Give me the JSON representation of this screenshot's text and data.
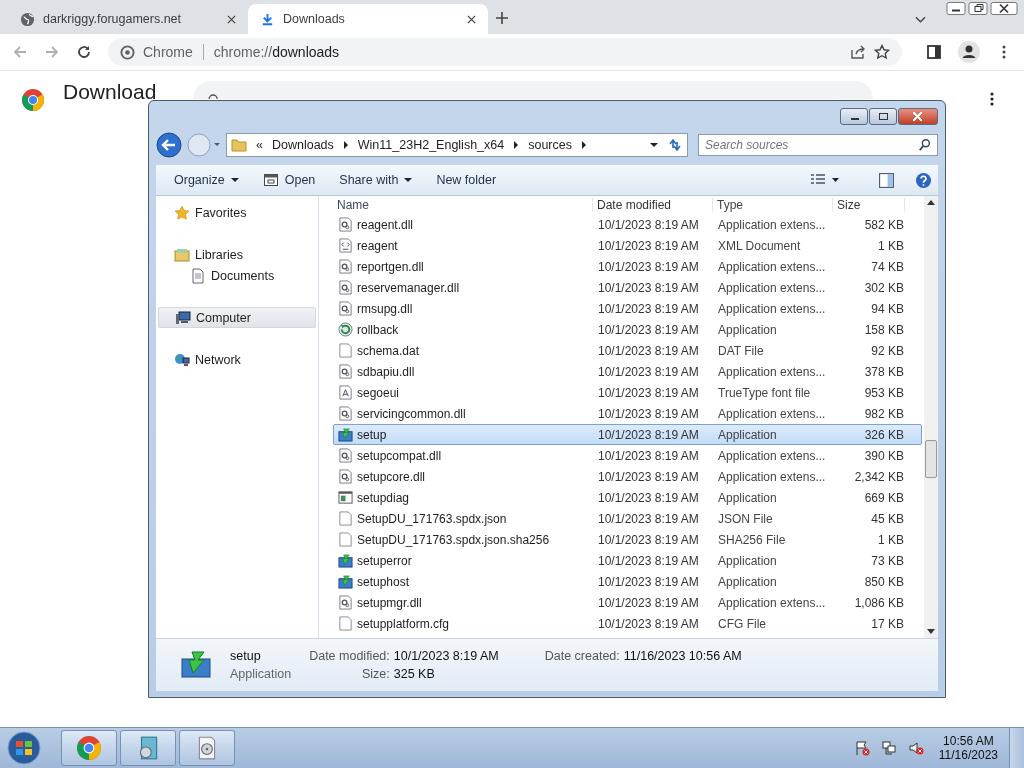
{
  "browser": {
    "tabs": [
      {
        "title": "darkriggy.forugamers.net",
        "selected": false
      },
      {
        "title": "Downloads",
        "selected": true
      }
    ],
    "omnibox": {
      "site": "Chrome",
      "url_scheme": "chrome://",
      "url_path": "downloads"
    }
  },
  "page": {
    "title": "Download"
  },
  "explorer": {
    "path": [
      "Downloads",
      "Win11_23H2_English_x64",
      "sources"
    ],
    "path_prefix": "«",
    "search": {
      "placeholder": "Search sources"
    },
    "toolbar": [
      {
        "label": "Organize",
        "kind": "menu"
      },
      {
        "label": "Open",
        "kind": "open"
      },
      {
        "label": "Share with",
        "kind": "menu"
      },
      {
        "label": "New folder",
        "kind": "plain"
      }
    ],
    "nav": [
      {
        "label": "Favorites",
        "kind": "star",
        "selected": false
      },
      {
        "label": "Libraries",
        "kind": "library",
        "selected": false,
        "children": [
          {
            "label": "Documents",
            "kind": "doc",
            "selected": false
          }
        ]
      },
      {
        "label": "Computer",
        "kind": "computer",
        "selected": true
      },
      {
        "label": "Network",
        "kind": "network",
        "selected": false
      }
    ],
    "columns": [
      "Name",
      "Date modified",
      "Type",
      "Size"
    ],
    "rows": [
      {
        "name": "reagent.dll",
        "kind": "dll",
        "date": "10/1/2023 8:19 AM",
        "type": "Application extens...",
        "size": "582 KB",
        "selected": false
      },
      {
        "name": "reagent",
        "kind": "xml",
        "date": "10/1/2023 8:19 AM",
        "type": "XML Document",
        "size": "1 KB",
        "selected": false
      },
      {
        "name": "reportgen.dll",
        "kind": "dll",
        "date": "10/1/2023 8:19 AM",
        "type": "Application extens...",
        "size": "74 KB",
        "selected": false
      },
      {
        "name": "reservemanager.dll",
        "kind": "dll",
        "date": "10/1/2023 8:19 AM",
        "type": "Application extens...",
        "size": "302 KB",
        "selected": false
      },
      {
        "name": "rmsupg.dll",
        "kind": "dll",
        "date": "10/1/2023 8:19 AM",
        "type": "Application extens...",
        "size": "94 KB",
        "selected": false
      },
      {
        "name": "rollback",
        "kind": "rollback",
        "date": "10/1/2023 8:19 AM",
        "type": "Application",
        "size": "158 KB",
        "selected": false
      },
      {
        "name": "schema.dat",
        "kind": "file",
        "date": "10/1/2023 8:19 AM",
        "type": "DAT File",
        "size": "92 KB",
        "selected": false
      },
      {
        "name": "sdbapiu.dll",
        "kind": "dll",
        "date": "10/1/2023 8:19 AM",
        "type": "Application extens...",
        "size": "378 KB",
        "selected": false
      },
      {
        "name": "segoeui",
        "kind": "font",
        "date": "10/1/2023 8:19 AM",
        "type": "TrueType font file",
        "size": "953 KB",
        "selected": false
      },
      {
        "name": "servicingcommon.dll",
        "kind": "dll",
        "date": "10/1/2023 8:19 AM",
        "type": "Application extens...",
        "size": "982 KB",
        "selected": false
      },
      {
        "name": "setup",
        "kind": "setup",
        "date": "10/1/2023 8:19 AM",
        "type": "Application",
        "size": "326 KB",
        "selected": true
      },
      {
        "name": "setupcompat.dll",
        "kind": "dll",
        "date": "10/1/2023 8:19 AM",
        "type": "Application extens...",
        "size": "390 KB",
        "selected": false
      },
      {
        "name": "setupcore.dll",
        "kind": "dll",
        "date": "10/1/2023 8:19 AM",
        "type": "Application extens...",
        "size": "2,342 KB",
        "selected": false
      },
      {
        "name": "setupdiag",
        "kind": "window",
        "date": "10/1/2023 8:19 AM",
        "type": "Application",
        "size": "669 KB",
        "selected": false
      },
      {
        "name": "SetupDU_171763.spdx.json",
        "kind": "file",
        "date": "10/1/2023 8:19 AM",
        "type": "JSON File",
        "size": "45 KB",
        "selected": false
      },
      {
        "name": "SetupDU_171763.spdx.json.sha256",
        "kind": "file",
        "date": "10/1/2023 8:19 AM",
        "type": "SHA256 File",
        "size": "1 KB",
        "selected": false
      },
      {
        "name": "setuperror",
        "kind": "setup",
        "date": "10/1/2023 8:19 AM",
        "type": "Application",
        "size": "73 KB",
        "selected": false
      },
      {
        "name": "setuphost",
        "kind": "setup",
        "date": "10/1/2023 8:19 AM",
        "type": "Application",
        "size": "850 KB",
        "selected": false
      },
      {
        "name": "setupmgr.dll",
        "kind": "dll",
        "date": "10/1/2023 8:19 AM",
        "type": "Application extens...",
        "size": "1,086 KB",
        "selected": false
      },
      {
        "name": "setupplatform.cfg",
        "kind": "file",
        "date": "10/1/2023 8:19 AM",
        "type": "CFG File",
        "size": "17 KB",
        "selected": false
      }
    ],
    "details": {
      "name": "setup",
      "type": "Application",
      "fields": [
        {
          "label": "Date modified:",
          "value": "10/1/2023 8:19 AM"
        },
        {
          "label": "Date created:",
          "value": "11/16/2023 10:56 AM"
        },
        {
          "label": "Size:",
          "value": "325 KB"
        }
      ]
    }
  },
  "taskbar": {
    "time": "10:56 AM",
    "date": "11/16/2023"
  }
}
